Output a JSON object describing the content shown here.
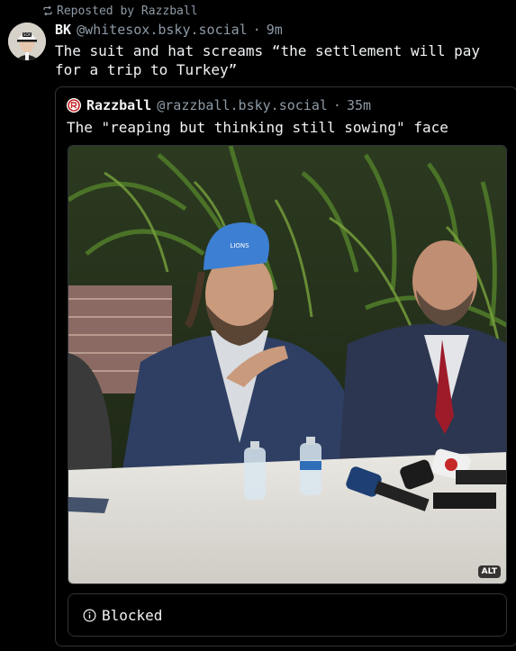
{
  "repost": {
    "text": "Reposted by Razzball",
    "icon": "repost-icon"
  },
  "post": {
    "author_name": "BK",
    "author_handle": "@whitesox.bsky.social",
    "separator": "·",
    "time": "9m",
    "text": "The suit and hat screams “the settlement will pay for a trip to Turkey”",
    "avatar_cap_text": "SOX"
  },
  "quote": {
    "author_name": "Razzball",
    "author_handle": "@razzball.bsky.social",
    "separator": "·",
    "time": "35m",
    "text": "The \"reaping but thinking still sowing\" face",
    "media": {
      "alt_badge": "ALT",
      "cap_text": "LIONS"
    },
    "blocked_label": "Blocked",
    "blocked_icon": "info-icon"
  },
  "colors": {
    "background": "#000000",
    "text": "#f1f3f5",
    "muted": "#8e9aa6",
    "border": "#2e3438",
    "cap_blue": "#3d7fd3",
    "tie_red": "#9e1b2a"
  }
}
